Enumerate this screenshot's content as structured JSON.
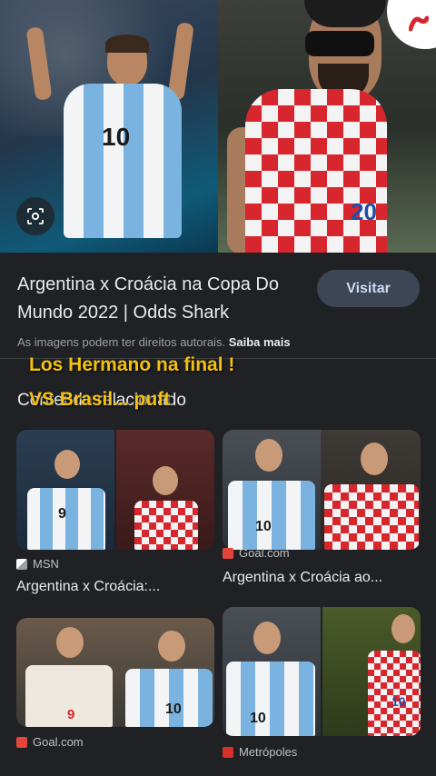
{
  "hero": {
    "left_jersey_number": "10",
    "right_jersey_number": "20"
  },
  "result": {
    "title": "Argentina x Croácia na Copa Do Mundo 2022 | Odds Shark",
    "visit_label": "Visitar",
    "copyright_text": "As imagens podem ter direitos autorais.",
    "copyright_more": "Saiba mais"
  },
  "related": {
    "heading": "Conteúdo relacionado"
  },
  "overlay": {
    "line1": "Los Hermano na final !",
    "line2": "VS Brasil... puft"
  },
  "cards": [
    {
      "source": "MSN",
      "caption": "Argentina x Croácia:...",
      "left_number": "9",
      "right_number": ""
    },
    {
      "source": "Goal.com",
      "caption": "Argentina x Croácia ao...",
      "left_number": "10",
      "right_number": ""
    },
    {
      "source": "Goal.com",
      "caption": "",
      "left_number": "9",
      "right_number": "10"
    },
    {
      "source": "Metrópoles",
      "caption": "",
      "left_number": "10",
      "right_number": "10"
    }
  ],
  "colors": {
    "background": "#202124",
    "overlay_text": "#f4c10e",
    "visit_button": "#3c4655",
    "goal_icon": "#e2463b",
    "metropoles_icon": "#d93025"
  }
}
